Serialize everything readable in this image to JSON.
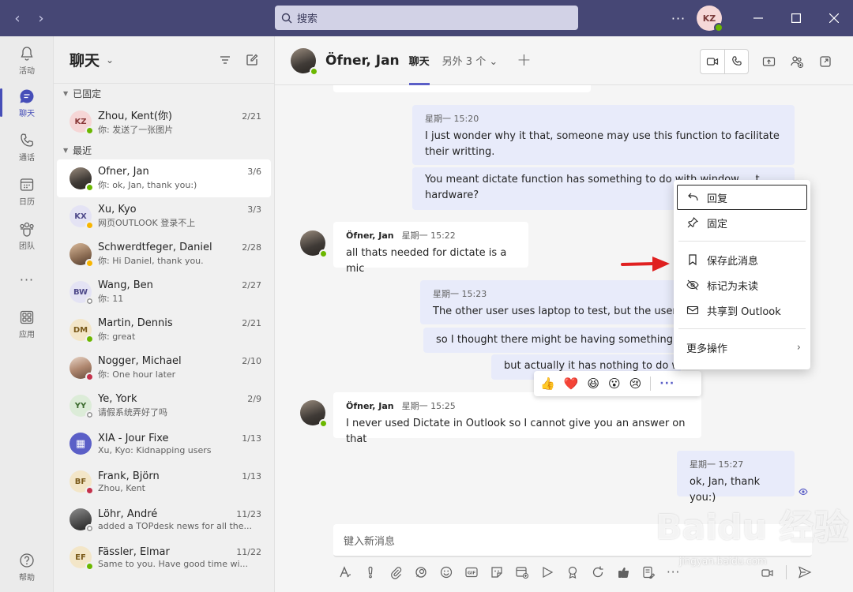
{
  "titlebar": {
    "back": "‹",
    "forward": "›",
    "search_placeholder": "搜索",
    "more": "···",
    "user_initials": "KZ"
  },
  "rail": {
    "items": [
      {
        "label": "活动",
        "icon": "bell-icon"
      },
      {
        "label": "聊天",
        "icon": "chat-icon"
      },
      {
        "label": "通话",
        "icon": "phone-icon"
      },
      {
        "label": "日历",
        "icon": "calendar-icon"
      },
      {
        "label": "团队",
        "icon": "teams-icon"
      },
      {
        "label": "···",
        "icon": "more-icon"
      },
      {
        "label": "应用",
        "icon": "apps-icon"
      },
      {
        "label": "帮助",
        "icon": "help-icon"
      }
    ]
  },
  "chatlist": {
    "title": "聊天",
    "pinned_label": "已固定",
    "recent_label": "最近",
    "pinned": [
      {
        "name": "Zhou, Kent(你)",
        "date": "2/21",
        "preview": "你: 发送了一张图片",
        "initials": "KZ",
        "avatar_bg": "#f6d6d6",
        "avatar_fg": "#8a3a3a",
        "status": "green"
      }
    ],
    "recent": [
      {
        "name": "Öfner, Jan",
        "date": "3/6",
        "preview": "你: ok, Jan, thank you:)",
        "initials": "",
        "photo": "photo",
        "status": "green"
      },
      {
        "name": "Xu, Kyo",
        "date": "3/3",
        "preview": "网页OUTLOOK 登录不上",
        "initials": "KX",
        "avatar_bg": "#e4e3f4",
        "avatar_fg": "#4f4a8a",
        "status": "amber"
      },
      {
        "name": "Schwerdtfeger, Daniel",
        "date": "2/28",
        "preview": "你: Hi Daniel, thank you.",
        "initials": "",
        "photo": "photo2",
        "status": "amber"
      },
      {
        "name": "Wang, Ben",
        "date": "2/27",
        "preview": "你: 11",
        "initials": "BW",
        "avatar_bg": "#e4e3f4",
        "avatar_fg": "#4f4a8a",
        "status": "grey"
      },
      {
        "name": "Martin, Dennis",
        "date": "2/21",
        "preview": "你: great",
        "initials": "DM",
        "avatar_bg": "#f3e6c8",
        "avatar_fg": "#7a5a1a",
        "status": "green"
      },
      {
        "name": "Nogger, Michael",
        "date": "2/10",
        "preview": "你: One hour later",
        "initials": "",
        "photo": "photo3",
        "status": "red"
      },
      {
        "name": "Ye, York",
        "date": "2/9",
        "preview": "请假系统弄好了吗",
        "initials": "YY",
        "avatar_bg": "#dcecd8",
        "avatar_fg": "#3c6b2f",
        "status": "grey"
      },
      {
        "name": "XIA - Jour Fixe",
        "date": "1/13",
        "preview": "Xu, Kyo: Kidnapping users",
        "initials": "▦",
        "avatar_bg": "#5b5fc7",
        "avatar_fg": "#ffffff",
        "status": ""
      },
      {
        "name": "Frank, Björn",
        "date": "1/13",
        "preview": "Zhou, Kent",
        "initials": "BF",
        "avatar_bg": "#f3e6c8",
        "avatar_fg": "#7a5a1a",
        "status": "red"
      },
      {
        "name": "Löhr, André",
        "date": "11/23",
        "preview": "added a TOPdesk news for all the...",
        "initials": "",
        "photo": "photo4",
        "status": "grey"
      },
      {
        "name": "Fässler, Elmar",
        "date": "11/22",
        "preview": "Same to you. Have good time wi...",
        "initials": "EF",
        "avatar_bg": "#f3e6c8",
        "avatar_fg": "#7a5a1a",
        "status": "green"
      }
    ]
  },
  "header": {
    "name": "Öfner, Jan",
    "tab": "聊天",
    "more_tabs": "另外 3 个 ⌄",
    "add": "+"
  },
  "messages": {
    "m1_meta": "星期一 15:20",
    "m1_text": "I just wonder why it that, someone may use this function to facilitate their writting.",
    "m2_text": "You meant dictate function has something to do with window ... t hardware?",
    "m3_sender": "Öfner, Jan",
    "m3_time": "星期一 15:22",
    "m3_text": "all thats needed for dictate is a mic",
    "m4_meta": "星期一 15:23",
    "m4_text": "The other user uses laptop to test, but the user st",
    "m5_text": "so I thought there might be having something to",
    "m6_text": "but actually it has nothing to do wi",
    "m7_sender": "Öfner, Jan",
    "m7_time": "星期一 15:25",
    "m7_text": "I never used Dictate in Outlook so I cannot give you an answer on that",
    "m8_meta": "星期一 15:27",
    "m8_text": "ok, Jan, thank you:)"
  },
  "reactions": [
    "👍",
    "❤️",
    "😆",
    "😮",
    "😢",
    "···"
  ],
  "context_menu": {
    "reply": "回复",
    "pin": "固定",
    "save": "保存此消息",
    "unread": "标记为未读",
    "share": "共享到 Outlook",
    "more": "更多操作"
  },
  "composer": {
    "placeholder": "键入新消息"
  },
  "watermark": {
    "brand": "Baidu 经验",
    "url": "jingyan.baidu.com"
  },
  "colors": {
    "titlebar": "#464775",
    "accent": "#5b5fc7",
    "bubble_out": "#e8ebfa",
    "arrow": "#e02020"
  }
}
